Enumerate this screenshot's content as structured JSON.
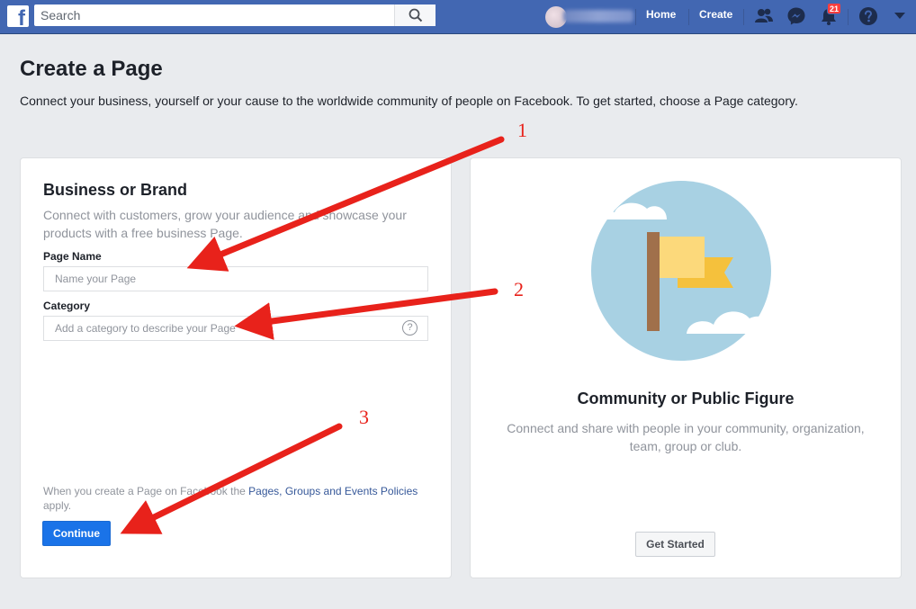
{
  "topbar": {
    "search_placeholder": "Search",
    "nav": {
      "home": "Home",
      "create": "Create"
    },
    "notifications_count": "21",
    "brand_color": "#4267b2"
  },
  "page": {
    "title": "Create a Page",
    "description": "Connect your business, yourself or your cause to the worldwide community of people on Facebook. To get started, choose a Page category."
  },
  "business_card": {
    "title": "Business or Brand",
    "description": "Connect with customers, grow your audience and showcase your products with a free business Page.",
    "page_name_label": "Page Name",
    "page_name_placeholder": "Name your Page",
    "category_label": "Category",
    "category_placeholder": "Add a category to describe your Page",
    "help_glyph": "?",
    "policy_prefix": "When you create a Page on Facebook the ",
    "policy_link": "Pages, Groups and Events Policies",
    "policy_suffix": " apply.",
    "continue_label": "Continue"
  },
  "community_card": {
    "title": "Community or Public Figure",
    "description": "Connect and share with people in your community, organization, team, group or club.",
    "get_started_label": "Get Started"
  },
  "annotations": {
    "color": "#e8221b",
    "labels": [
      "1",
      "2",
      "3"
    ]
  }
}
